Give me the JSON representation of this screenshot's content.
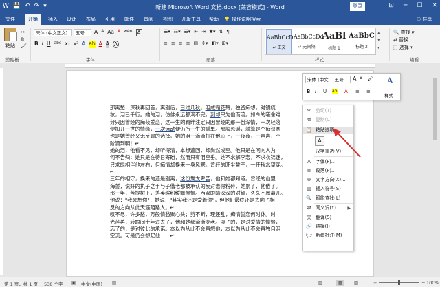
{
  "window": {
    "title": "新建 Microsoft Word 文档.docx [兼容模式] - Word",
    "login": "登录",
    "controls": [
      "⊡",
      "─",
      "☐",
      "✕"
    ]
  },
  "quick_access": [
    "W",
    "💾",
    "↶",
    "↷",
    "▾"
  ],
  "tabs": [
    "文件",
    "开始",
    "插入",
    "设计",
    "布局",
    "引用",
    "邮件",
    "审阅",
    "视图",
    "开发工具",
    "帮助"
  ],
  "active_tab": "开始",
  "tell_me": "操作说明搜索",
  "share": "共享",
  "ribbon": {
    "clipboard": {
      "paste": "粘贴",
      "label": "剪贴板"
    },
    "font": {
      "name": "宋体 (中文正文)",
      "size": "五号",
      "grow": "A",
      "shrink": "A",
      "aa": "Aa",
      "wen": "wén",
      "a_box": "A",
      "bold": "B",
      "italic": "I",
      "underline": "U",
      "strike": "abc",
      "sub": "x₂",
      "sup": "x²",
      "color_a": "A",
      "highlight": "ab",
      "font_color": "A",
      "charshade": "A",
      "circle": "A",
      "label": "字体"
    },
    "paragraph": {
      "label": "段落"
    },
    "styles": {
      "items": [
        {
          "sample": "AaBbCcDd",
          "name": "↵ 正文"
        },
        {
          "sample": "AaBbCcDd",
          "name": "↵ 无间隔"
        },
        {
          "sample": "AaBl",
          "name": "标题 1"
        },
        {
          "sample": "AaBbC",
          "name": "标题 2"
        }
      ],
      "label": "样式"
    },
    "editing": {
      "find": "查找 ▾",
      "replace": "替换",
      "select": "选择 ▾",
      "label": "编辑"
    }
  },
  "document": {
    "paragraphs": [
      [
        "那离愁，深秋再回首，离别后，",
        {
          "u": "已过几秋"
        },
        "。",
        {
          "u": "泪戚霜花"
        },
        "殇，独留痴想，对镜梳"
      ],
      [
        "妆，泪已千行。她的泪，仿佛永远都滴不完，",
        {
          "u": "刻却"
        },
        "只为他而流。如今的嗟舍难"
      ],
      [
        "分只因曾经的",
        {
          "u": "痴莜爱恋"
        },
        "，这一生的羁绊注定只因曾经的那一份深情，一次轻落"
      ],
      [
        "便扣开一世的情缘，",
        {
          "u": "一次远动"
        },
        "便仍所一生的孤单。那般恐谣，就算是个痴识寒"
      ],
      [
        "也是她曾经又无反顾的选择。她的泪一滴滴打在他心上，一夜夜，一声声，空"
      ],
      [
        "阶滴到明！↵"
      ],
      [
        "她的泪，他看不见，却听得清，本想追回，却尚然成空。他只是在问向人为"
      ],
      [
        "何不告归：她只是在待日寄盼，然而只有",
        {
          "u": "泪空垂"
        },
        "。她不求解李宏，不求衣锦迷，"
      ],
      [
        "只求能相伴他左右，但痴情却换来一身风寒。曾经的旺尘誓空，一任秋水望穿。"
      ],
      [
        "↵"
      ],
      [
        "三年的相守，换来的还是别离，",
        {
          "u": "这份爱太卑苦"
        },
        "，他和她都知道。曾经的山盟"
      ],
      [
        "海誓，说好的执子之手与子偕老都被承认的反对击得粉碎，她累了，",
        {
          "u": "他倦了"
        },
        "。"
      ],
      [
        "那一年，苦提树下，落英缤纷缓飘慢慢。西双眼睛深深的对望，久久不愿离开。"
      ],
      [
        "他说：\"我会想你\"，她说：\"其实我还是爱着你\"，但他们最终还是去向了相"
      ],
      [
        "反的方向从此天涯陌路人。↵"
      ],
      [
        "叹不尽，许多愁，万般情愁聚心头；剪不断，理还乱，痴情誓恋何时休。时"
      ],
      [
        "光荏苒，转眼间十年过去了，他和她都渐渐变老。淡了的，是对爱情的憧憬，"
      ],
      [
        "忘了的，是对彼此的承诺。本以为从此不会再想他，本以为从此不会再独自泪"
      ],
      [
        "空流。可是仍会想起他……↵"
      ]
    ]
  },
  "mini_toolbar": {
    "font": "宋体 (中文",
    "size": "五号",
    "grow": "A",
    "shrink": "A",
    "brush": "🖌",
    "style_a": "A",
    "styles_label": "样式",
    "bold": "B",
    "italic": "I",
    "underline": "U",
    "highlight": "ab",
    "color": "A",
    "bullets": "≡",
    "numbering": "≡"
  },
  "context_menu": [
    {
      "icon": "✂",
      "label": "剪切(T)",
      "disabled": true
    },
    {
      "icon": "⧉",
      "label": "复制(C)",
      "disabled": true
    },
    {
      "icon": "📋",
      "label": "粘贴选项:",
      "disabled": false,
      "highlight": true
    },
    {
      "icon": "",
      "label": "",
      "disabled": false,
      "is_paste_option": true
    },
    {
      "icon": "",
      "label": "汉字重选(V)",
      "disabled": false
    },
    {
      "icon": "A",
      "label": "字体(F)...",
      "disabled": false
    },
    {
      "icon": "≡",
      "label": "段落(P)...",
      "disabled": false
    },
    {
      "icon": "⊕",
      "label": "文字方向(X)...",
      "disabled": false
    },
    {
      "icon": "▥",
      "label": "插入符号(S)",
      "disabled": false
    },
    {
      "icon": "🔍",
      "label": "智能查找(L)",
      "disabled": false
    },
    {
      "icon": "⇄",
      "label": "同义词(Y)",
      "disabled": false,
      "submenu": true
    },
    {
      "icon": "文",
      "label": "翻译(S)",
      "disabled": false
    },
    {
      "icon": "🔗",
      "label": "链接(I)",
      "disabled": false
    },
    {
      "icon": "💬",
      "label": "新建批注(M)",
      "disabled": false
    }
  ],
  "status_bar": {
    "page": "第 1 页，共 1 页",
    "words": "538 个字",
    "lang": "中文(中国)",
    "zoom": "100%"
  },
  "colors": {
    "title_bar": "#2b579a",
    "arrow": "#d63030",
    "underline": "#1f4ea8"
  }
}
